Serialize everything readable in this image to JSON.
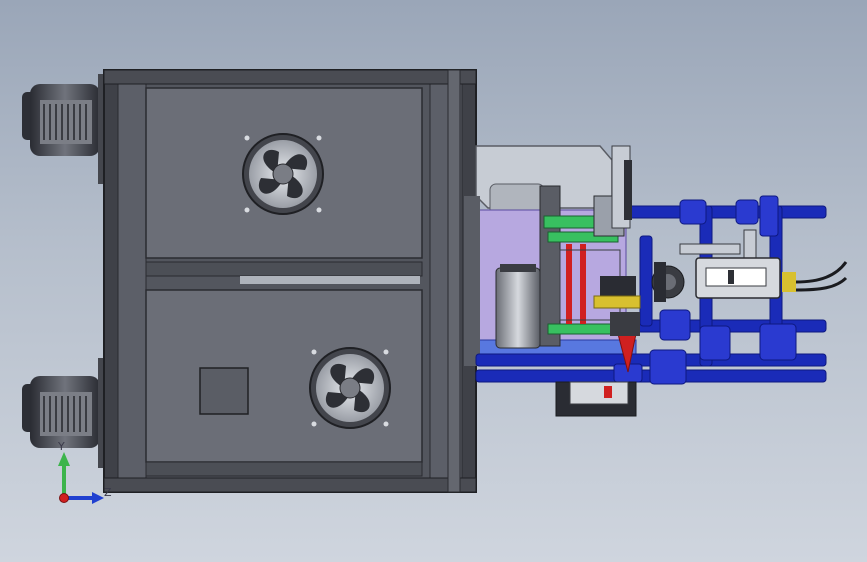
{
  "viewport": {
    "background_top": "#9aa6b8",
    "background_bottom": "#cfd5de"
  },
  "colors": {
    "frame_dark": "#3f4148",
    "frame_mid": "#5c5f68",
    "panel_fill": "#6b6e77",
    "steel_light": "#c7ccd4",
    "pipe_blue": "#1a2bb8",
    "pipe_blue_dark": "#0d1880",
    "lilac": "#b7a8e0",
    "green_part": "#38c060",
    "red_part": "#d02020",
    "yellow_part": "#d8c030"
  },
  "triad": {
    "y_label": "Y",
    "z_label": "Z",
    "y_axis_color": "#3cb44b",
    "z_axis_color": "#2040d0",
    "origin_color": "#d02020"
  },
  "icons": {
    "fan_top": "cooling-fan-icon",
    "fan_bottom": "cooling-fan-icon",
    "axis_triad": "coordinate-triad-icon"
  }
}
